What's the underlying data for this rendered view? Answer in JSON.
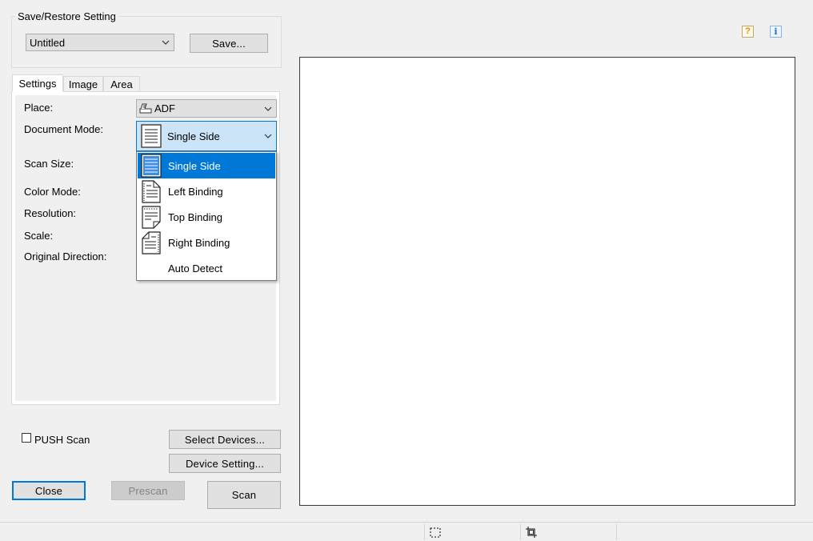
{
  "save_restore": {
    "group_title": "Save/Restore Setting",
    "preset_value": "Untitled",
    "save_button": "Save..."
  },
  "help_icons": {
    "help": "?",
    "info": "i"
  },
  "tabs": [
    {
      "label": "Settings",
      "active": true
    },
    {
      "label": "Image",
      "active": false
    },
    {
      "label": "Area",
      "active": false
    }
  ],
  "settings": {
    "place": {
      "label": "Place:",
      "value": "ADF"
    },
    "document_mode": {
      "label": "Document Mode:",
      "value": "Single Side"
    },
    "scan_size": {
      "label": "Scan Size:"
    },
    "color_mode": {
      "label": "Color Mode:"
    },
    "resolution": {
      "label": "Resolution:"
    },
    "scale": {
      "label": "Scale:"
    },
    "original_direction": {
      "label": "Original Direction:"
    }
  },
  "document_mode_dropdown": {
    "options": [
      {
        "label": "Single Side",
        "icon": "single-side-icon",
        "selected": true
      },
      {
        "label": "Left Binding",
        "icon": "left-binding-icon",
        "selected": false
      },
      {
        "label": "Top Binding",
        "icon": "top-binding-icon",
        "selected": false
      },
      {
        "label": "Right Binding",
        "icon": "right-binding-icon",
        "selected": false
      },
      {
        "label": "Auto Detect",
        "icon": "",
        "selected": false
      }
    ]
  },
  "bottom": {
    "push_scan_label": "PUSH Scan",
    "select_devices": "Select Devices...",
    "device_setting": "Device Setting...",
    "close": "Close",
    "prescan": "Prescan",
    "scan": "Scan"
  },
  "colors": {
    "accent": "#0078d7",
    "dropdown_highlight": "#cce4f7",
    "help_icon": "#e08a00",
    "info_icon": "#1a6fd0"
  }
}
